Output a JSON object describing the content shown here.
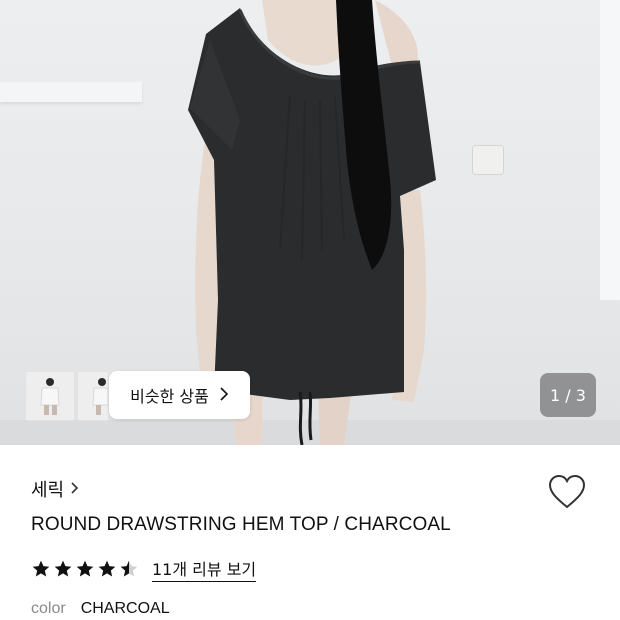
{
  "gallery": {
    "main_image": "model-wearing-charcoal-top",
    "current_index": 1,
    "total_images": 3,
    "counter_text": "1 / 3",
    "similar_products_label": "비슷한 상품",
    "thumbnails": [
      "thumb-white-top-1",
      "thumb-white-top-2"
    ]
  },
  "product": {
    "brand": "세릭",
    "name": "ROUND DRAWSTRING HEM TOP / CHARCOAL",
    "rating": 4.5,
    "review_link_text": "11개 리뷰 보기",
    "color_label": "color",
    "color_value": "CHARCOAL"
  },
  "icons": {
    "brand_chevron": "chevron-right-icon",
    "similar_chevron": "chevron-right-icon",
    "wishlist": "heart-outline-icon",
    "star": "star-icon"
  },
  "colors": {
    "text": "#111111",
    "muted": "#8a8a8a",
    "star": "#111111",
    "star_empty": "#cfcfcf",
    "garment": "#2b2c2e"
  }
}
